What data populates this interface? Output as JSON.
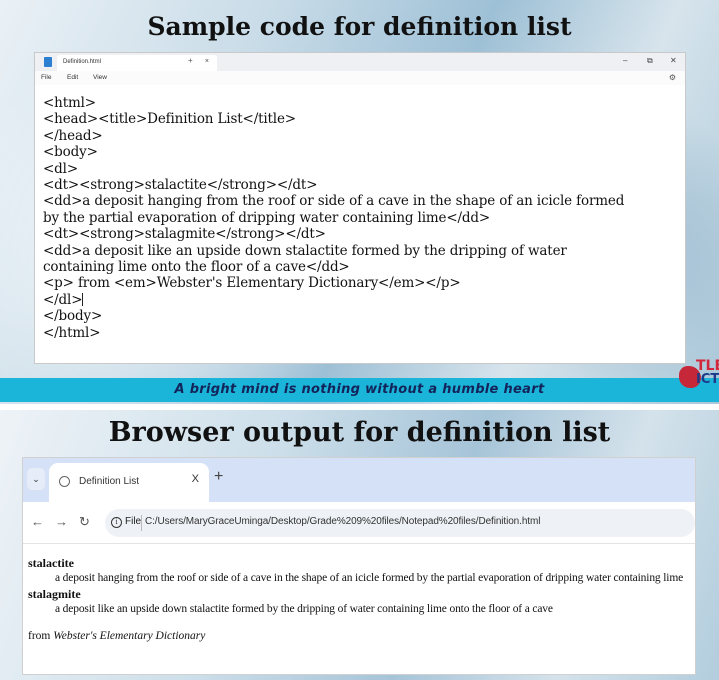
{
  "slide_top": {
    "title": "Sample code for definition list",
    "banner_text": "A bright mind is nothing without a humble heart",
    "logo_text_top": "TLE",
    "logo_text_bottom": "ICT"
  },
  "notepad": {
    "tab_title": "Definition.html",
    "tab_close": "×",
    "new_tab": "+",
    "controls": {
      "minimize": "–",
      "maximize": "⧉",
      "close": "✕"
    },
    "menu": [
      "File",
      "Edit",
      "View"
    ],
    "settings_glyph": "⚙",
    "lines": [
      "<html>",
      "<head><title>Definition List</title>",
      "</head>",
      "<body>",
      "<dl>",
      "<dt><strong>stalactite</strong></dt>",
      "<dd>a deposit hanging from the roof or side of a cave in the shape of an icicle formed",
      "by the partial evaporation of dripping water containing lime</dd>",
      "<dt><strong>stalagmite</strong></dt>",
      "<dd>a deposit like an upside down stalactite formed by the dripping of water",
      "containing lime onto the floor of a cave</dd>",
      "<p> from <em>Webster's Elementary Dictionary</em></p>",
      "</dl>",
      "</body>",
      "</html>"
    ]
  },
  "slide_bottom": {
    "title": "Browser output for definition list"
  },
  "browser": {
    "tab_menu_glyph": "⌄",
    "tab_title": "Definition List",
    "tab_close": "X",
    "new_tab": "+",
    "nav": {
      "back": "←",
      "forward": "→",
      "reload": "↻"
    },
    "info_glyph": "i",
    "scheme_label": "File",
    "url": "C:/Users/MaryGraceUminga/Desktop/Grade%209%20files/Notepad%20files/Definition.html",
    "content": {
      "dt1": "stalactite",
      "dd1": "a deposit hanging from the roof or side of a cave in the shape of an icicle formed by the partial evaporation of dripping water containing lime",
      "dt2": "stalagmite",
      "dd2": "a deposit like an upside down stalactite formed by the dripping of water containing lime onto the floor of a cave",
      "p_prefix": "from ",
      "p_em": "Webster's Elementary Dictionary"
    }
  }
}
